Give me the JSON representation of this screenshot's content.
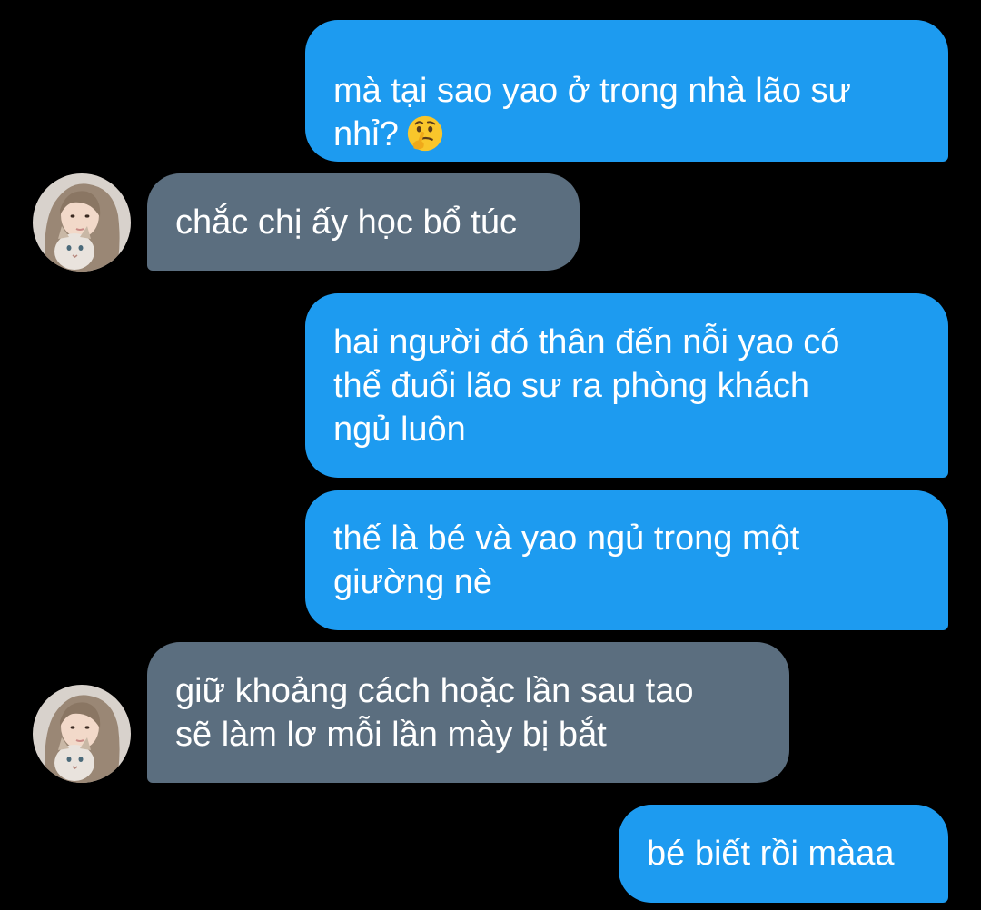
{
  "conversation": {
    "messages": [
      {
        "direction": "sent",
        "text": "mà tại sao yao ở trong nhà lão sư\nnhỉ?",
        "emoji": "thinking-face-icon"
      },
      {
        "direction": "received",
        "text": "chắc chị ấy học bổ túc"
      },
      {
        "direction": "sent",
        "text": "hai người đó thân đến nỗi yao có\nthể đuổi lão sư ra phòng khách\nngủ luôn"
      },
      {
        "direction": "sent",
        "text": "thế là bé và yao ngủ trong một\ngiường nè"
      },
      {
        "direction": "received",
        "text": "giữ khoảng cách hoặc lần sau tao\nsẽ làm lơ mỗi lần mày bị bắt"
      },
      {
        "direction": "sent",
        "text": "bé biết rồi màaa"
      }
    ]
  },
  "colors": {
    "background": "#000000",
    "sent_bubble": "#1d9bf0",
    "received_bubble": "#5b6e7f",
    "text": "#ffffff"
  }
}
